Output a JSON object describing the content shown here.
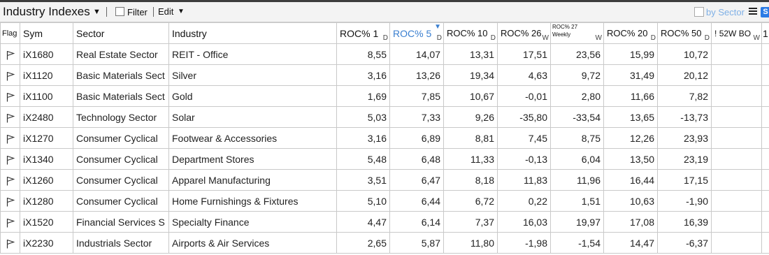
{
  "toolbar": {
    "title": "Industry Indexes",
    "filter_label": "Filter",
    "edit_label": "Edit",
    "by_sector_label": "by Sector",
    "s_badge": "S"
  },
  "columns": {
    "flag": "Flag",
    "sym": "Sym",
    "sector": "Sector",
    "industry": "Industry",
    "roc1": "ROC% 1",
    "roc1_unit": "D",
    "roc5": "ROC% 5",
    "roc5_unit": "D",
    "roc10": "ROC% 10",
    "roc10_unit": "D",
    "roc26": "ROC% 26",
    "roc26_unit": "W",
    "roc27_line1": "ROC% 27",
    "roc27_line2": "Weekly",
    "roc27_unit": "W",
    "roc20": "ROC% 20",
    "roc20_unit": "D",
    "roc50": "ROC% 50",
    "roc50_unit": "D",
    "w52": "52W BO",
    "w52_prefix": "!",
    "w52_unit": "W",
    "last": "1"
  },
  "rows": [
    {
      "sym": "iX1680",
      "sector": "Real Estate Sector",
      "industry": "REIT - Office",
      "roc1": "8,55",
      "roc5": "14,07",
      "roc10": "13,31",
      "roc26": "17,51",
      "roc27": "23,56",
      "roc20": "15,99",
      "roc50": "10,72"
    },
    {
      "sym": "iX1120",
      "sector": "Basic Materials Sect",
      "industry": "Silver",
      "roc1": "3,16",
      "roc5": "13,26",
      "roc10": "19,34",
      "roc26": "4,63",
      "roc27": "9,72",
      "roc20": "31,49",
      "roc50": "20,12"
    },
    {
      "sym": "iX1100",
      "sector": "Basic Materials Sect",
      "industry": "Gold",
      "roc1": "1,69",
      "roc5": "7,85",
      "roc10": "10,67",
      "roc26": "-0,01",
      "roc27": "2,80",
      "roc20": "11,66",
      "roc50": "7,82"
    },
    {
      "sym": "iX2480",
      "sector": "Technology Sector",
      "industry": "Solar",
      "roc1": "5,03",
      "roc5": "7,33",
      "roc10": "9,26",
      "roc26": "-35,80",
      "roc27": "-33,54",
      "roc20": "13,65",
      "roc50": "-13,73"
    },
    {
      "sym": "iX1270",
      "sector": "Consumer Cyclical",
      "industry": "Footwear & Accessories",
      "roc1": "3,16",
      "roc5": "6,89",
      "roc10": "8,81",
      "roc26": "7,45",
      "roc27": "8,75",
      "roc20": "12,26",
      "roc50": "23,93"
    },
    {
      "sym": "iX1340",
      "sector": "Consumer Cyclical",
      "industry": "Department Stores",
      "roc1": "5,48",
      "roc5": "6,48",
      "roc10": "11,33",
      "roc26": "-0,13",
      "roc27": "6,04",
      "roc20": "13,50",
      "roc50": "23,19"
    },
    {
      "sym": "iX1260",
      "sector": "Consumer Cyclical",
      "industry": "Apparel Manufacturing",
      "roc1": "3,51",
      "roc5": "6,47",
      "roc10": "8,18",
      "roc26": "11,83",
      "roc27": "11,96",
      "roc20": "16,44",
      "roc50": "17,15"
    },
    {
      "sym": "iX1280",
      "sector": "Consumer Cyclical",
      "industry": "Home Furnishings & Fixtures",
      "roc1": "5,10",
      "roc5": "6,44",
      "roc10": "6,72",
      "roc26": "0,22",
      "roc27": "1,51",
      "roc20": "10,63",
      "roc50": "-1,90"
    },
    {
      "sym": "iX1520",
      "sector": "Financial Services S",
      "industry": "Specialty Finance",
      "roc1": "4,47",
      "roc5": "6,14",
      "roc10": "7,37",
      "roc26": "16,03",
      "roc27": "19,97",
      "roc20": "17,08",
      "roc50": "16,39"
    },
    {
      "sym": "iX2230",
      "sector": "Industrials Sector",
      "industry": "Airports & Air Services",
      "roc1": "2,65",
      "roc5": "5,87",
      "roc10": "11,80",
      "roc26": "-1,98",
      "roc27": "-1,54",
      "roc20": "14,47",
      "roc50": "-6,37"
    }
  ]
}
